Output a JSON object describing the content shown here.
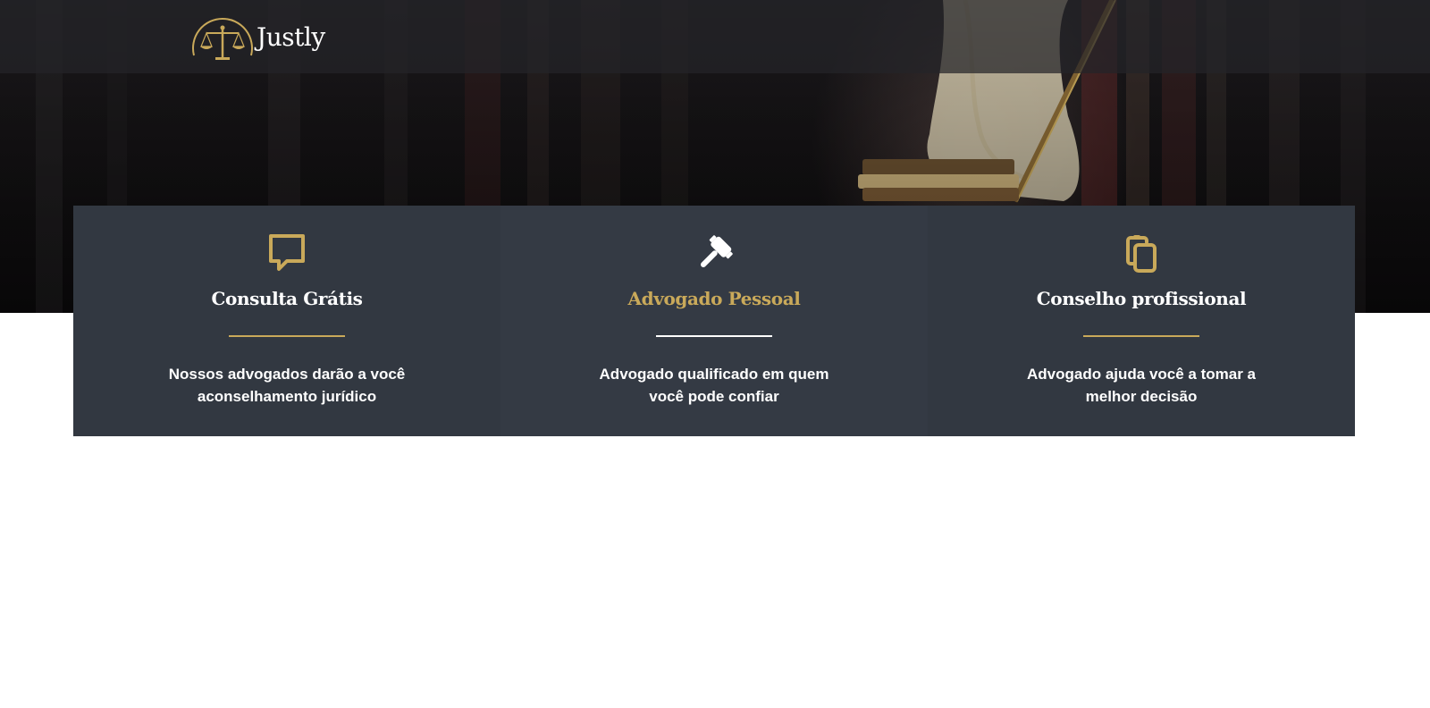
{
  "brand": {
    "name": "Justly",
    "logo_icon": "scales-of-justice-icon",
    "accent_color": "#c9a95a"
  },
  "hero": {
    "background": "law-library-with-lady-justice-statue"
  },
  "features": [
    {
      "icon": "chat-bubble-icon",
      "title": "Consulta Grátis",
      "desc_line1": "Nossos advogados darão a você",
      "desc_line2": "aconselhamento jurídico"
    },
    {
      "icon": "gavel-icon",
      "title": "Advogado Pessoal",
      "desc_line1": "Advogado qualificado em quem",
      "desc_line2": "você pode confiar"
    },
    {
      "icon": "clipboard-copy-icon",
      "title": "Conselho profissional",
      "desc_line1": "Advogado ajuda você a tomar a",
      "desc_line2": "melhor decisão"
    }
  ]
}
